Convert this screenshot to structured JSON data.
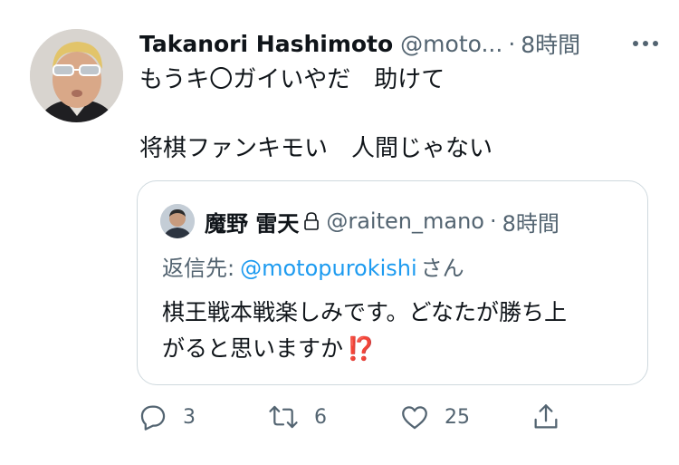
{
  "tweet": {
    "author_name": "Takanori Hashimoto",
    "author_handle": "@moto...",
    "separator": "·",
    "time": "8時間",
    "lines": [
      "もうキ〇ガイいやだ　助けて",
      "将棋ファンキモい　人間じゃない"
    ]
  },
  "quote": {
    "author_name": "魔野 雷天",
    "author_handle": "@raiten_mano",
    "separator": "·",
    "time": "8時間",
    "reply_prefix": "返信先:",
    "reply_mention": "@motopurokishi",
    "reply_suffix": "さん",
    "text_line1": "棋王戦本戦楽しみです。どなたが勝ち上",
    "text_line2": "がると思いますか",
    "text_emoji": "⁉️"
  },
  "actions": {
    "reply_count": "3",
    "retweet_count": "6",
    "like_count": "25"
  },
  "colors": {
    "text": "#0f1419",
    "secondary": "#536471",
    "link": "#1d9bf0",
    "border": "#cfd9de",
    "emoji": "#e0245e"
  },
  "icons": [
    "more-icon",
    "lock-icon",
    "reply-icon",
    "retweet-icon",
    "like-icon",
    "share-icon"
  ]
}
